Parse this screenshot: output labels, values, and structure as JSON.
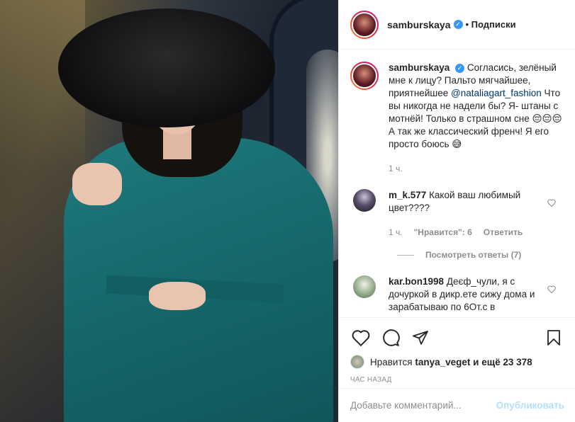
{
  "post": {
    "author": "samburskaya",
    "follow_label": "• Подписки",
    "more_icon": "more-icon",
    "caption_user": "samburskaya",
    "caption_part1": "Согласись, зелёный мне к лицу? Пальто мягчайшее, приятнейшее",
    "caption_mention": "@nataliagart_fashion",
    "caption_part2": "Что вы никогда не надели бы? Я- штаны с мотнёй! Только в страшном сне 😔😔😔 А так же классический френч! Я его просто боюсь 😅",
    "caption_time": "1 ч."
  },
  "comments": [
    {
      "user": "m_k.577",
      "text": "Какой ваш любимый цвет????",
      "time": "1 ч.",
      "likes": "\"Нравится\": 6",
      "reply": "Ответить",
      "view_replies": "Посмотреть ответы (7)"
    },
    {
      "user": "kar.bon1998",
      "text": "Деєф_чули, я с дочуркой в дикр.ете сижу дома и зарабатываю по 6От.с в"
    }
  ],
  "actions": {
    "likes_prefix": "Нравится",
    "likes_user": "tanya_veget",
    "likes_suffix": "и ещё 23 378",
    "time_ago": "час назад"
  },
  "add_comment": {
    "placeholder": "Добавьте комментарий...",
    "publish_label": "Опубликовать"
  },
  "colors": {
    "verified": "#3897f0",
    "publish": "#b2dffc",
    "coat": "#1f7a7d"
  }
}
